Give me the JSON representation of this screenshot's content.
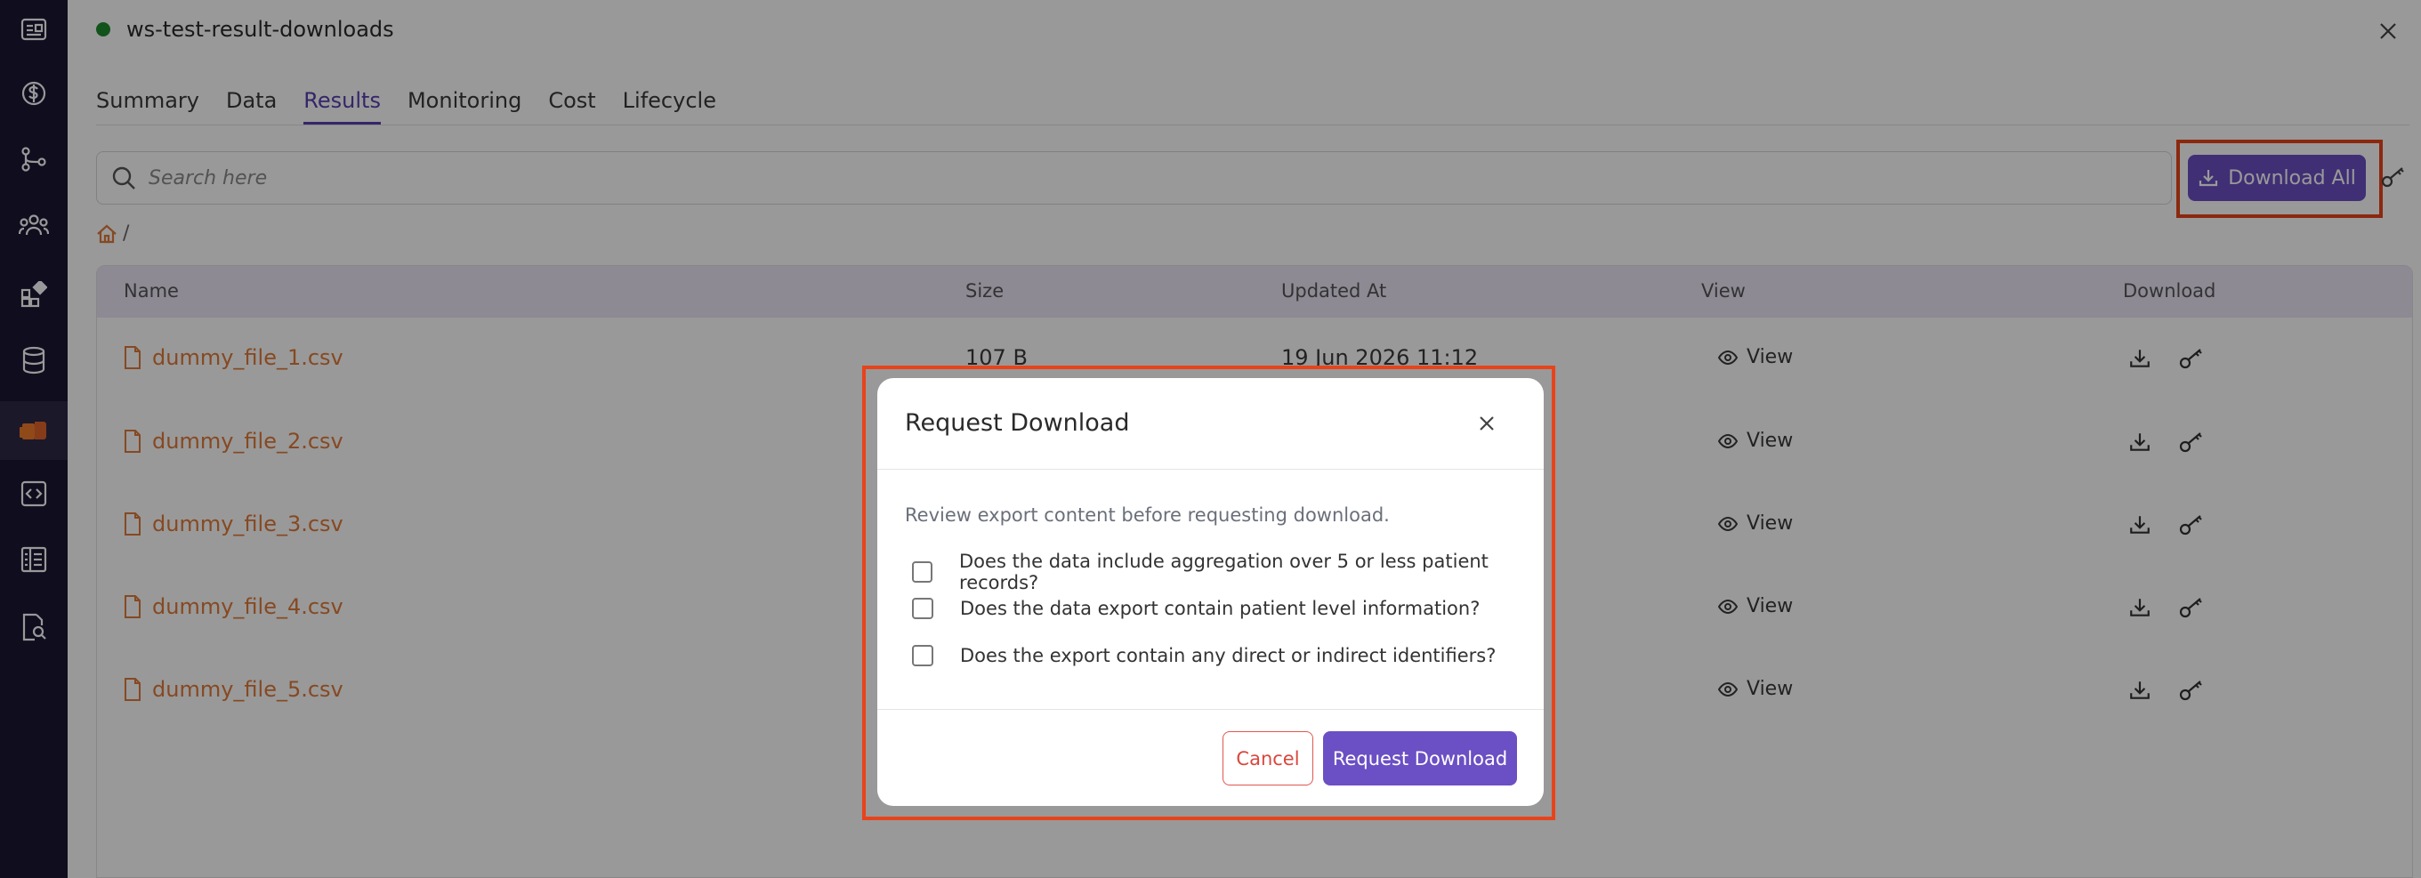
{
  "app": {
    "workspace_title": "ws-test-result-downloads",
    "status_color": "#1f8a2e",
    "accent_color": "#6b4fc4",
    "highlight_color": "#e8431a"
  },
  "sidebar": {
    "items": [
      {
        "icon": "dashboard-card-icon",
        "active": false
      },
      {
        "icon": "dollar-circle-icon",
        "active": false
      },
      {
        "icon": "workflow-nodes-icon",
        "active": false
      },
      {
        "icon": "users-group-icon",
        "active": false
      },
      {
        "icon": "apps-grid-icon",
        "active": false
      },
      {
        "icon": "database-icon",
        "active": false
      },
      {
        "icon": "workspace-folder-icon",
        "active": true
      },
      {
        "icon": "code-window-icon",
        "active": false
      },
      {
        "icon": "catalog-table-icon",
        "active": false
      },
      {
        "icon": "document-search-icon",
        "active": false
      }
    ]
  },
  "tabs": [
    {
      "label": "Summary",
      "active": false
    },
    {
      "label": "Data",
      "active": false
    },
    {
      "label": "Results",
      "active": true
    },
    {
      "label": "Monitoring",
      "active": false
    },
    {
      "label": "Cost",
      "active": false
    },
    {
      "label": "Lifecycle",
      "active": false
    }
  ],
  "search": {
    "placeholder": "Search here",
    "value": ""
  },
  "toolbar": {
    "download_all_label": "Download All"
  },
  "breadcrumb": {
    "separator": "/"
  },
  "table": {
    "headers": {
      "name": "Name",
      "size": "Size",
      "updated_at": "Updated At",
      "view": "View",
      "download": "Download"
    },
    "rows": [
      {
        "name": "dummy_file_1.csv",
        "size": "107 B",
        "updated_at": "19 Jun 2026 11:12",
        "view_label": "View"
      },
      {
        "name": "dummy_file_2.csv",
        "size": "",
        "updated_at": "",
        "view_label": "View"
      },
      {
        "name": "dummy_file_3.csv",
        "size": "",
        "updated_at": "",
        "view_label": "View"
      },
      {
        "name": "dummy_file_4.csv",
        "size": "",
        "updated_at": "",
        "view_label": "View"
      },
      {
        "name": "dummy_file_5.csv",
        "size": "",
        "updated_at": "",
        "view_label": "View"
      }
    ]
  },
  "modal": {
    "title": "Request Download",
    "description": "Review export content before requesting download.",
    "questions": [
      {
        "label": "Does the data include aggregation over 5 or less patient records?",
        "checked": false
      },
      {
        "label": "Does the data export contain patient level information?",
        "checked": false
      },
      {
        "label": "Does the export contain any direct or indirect identifiers?",
        "checked": false
      }
    ],
    "cancel_label": "Cancel",
    "submit_label": "Request Download"
  }
}
